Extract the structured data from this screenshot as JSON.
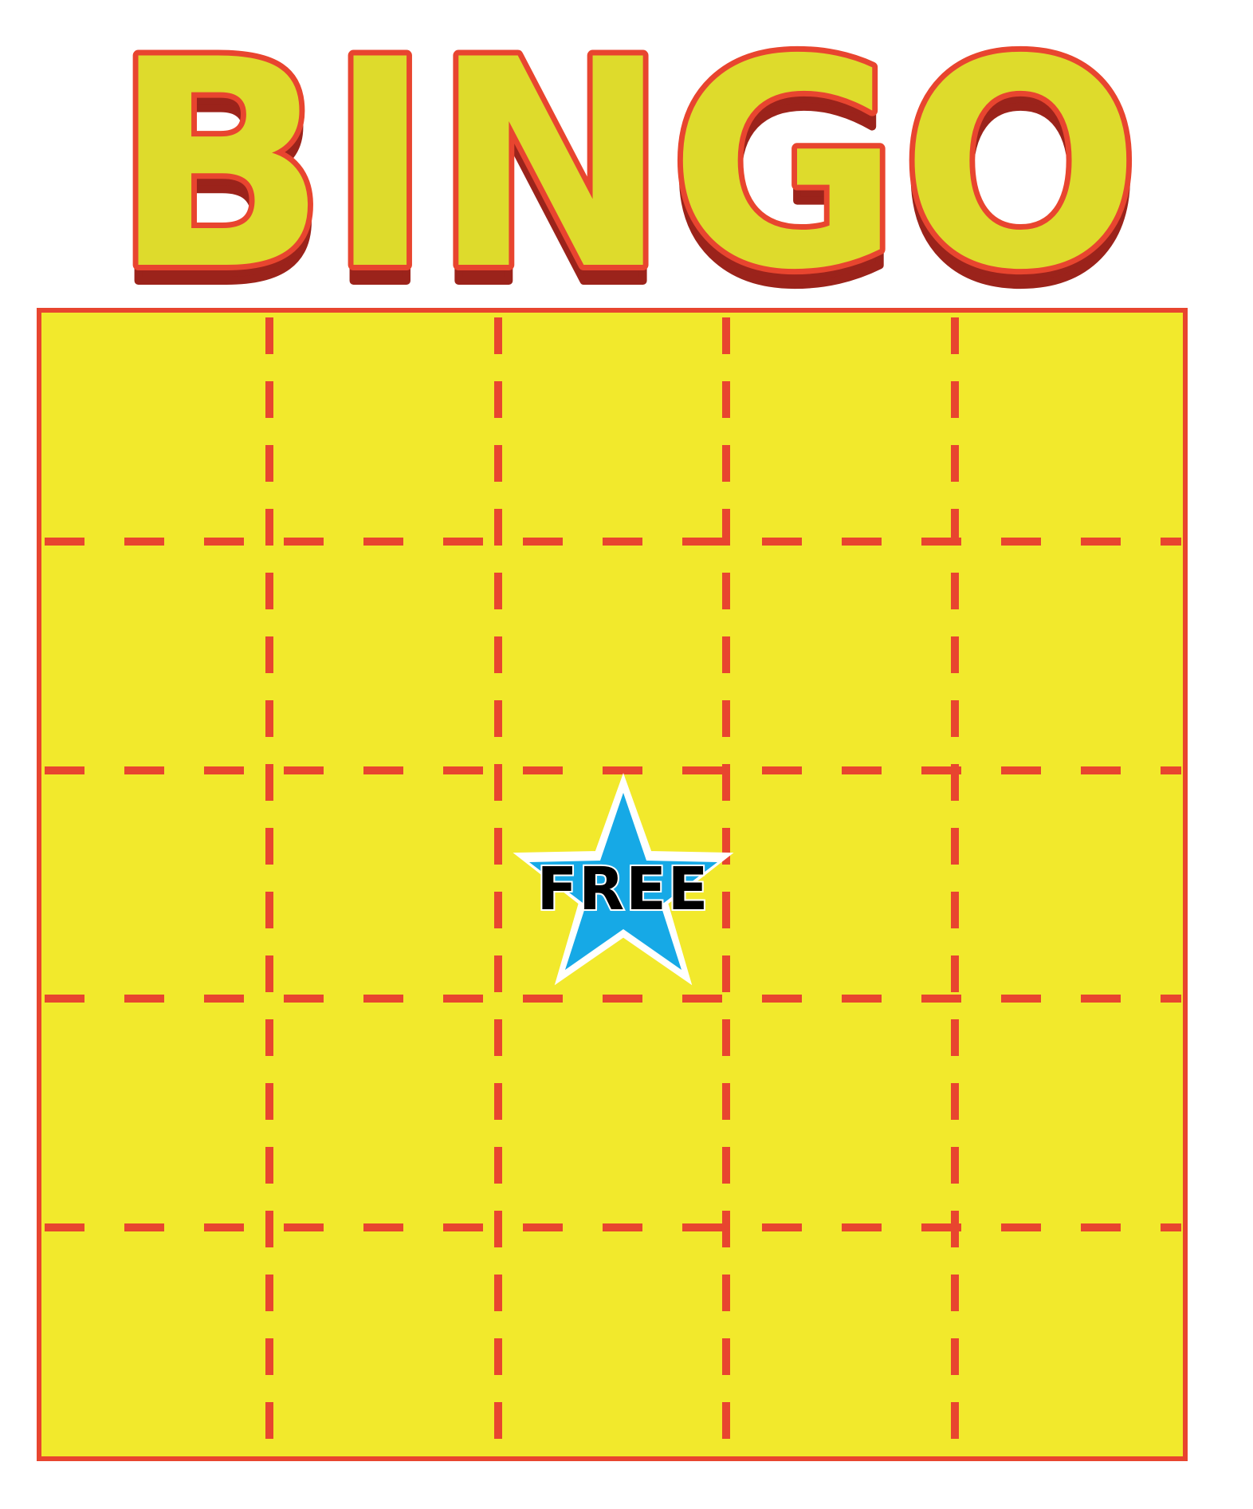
{
  "title": {
    "text": "BINGO",
    "fill_color": "#dedb2c",
    "outline_color": "#e8452f",
    "shadow_color": "#9b231b"
  },
  "board": {
    "background_color": "#f2e92c",
    "border_color": "#e8452f",
    "dash_color": "#e8452f",
    "columns": 5,
    "rows": 5
  },
  "free_space": {
    "label": "FREE",
    "icon": "star-icon",
    "star_color": "#16a9e6",
    "star_outline": "#ffffff"
  }
}
